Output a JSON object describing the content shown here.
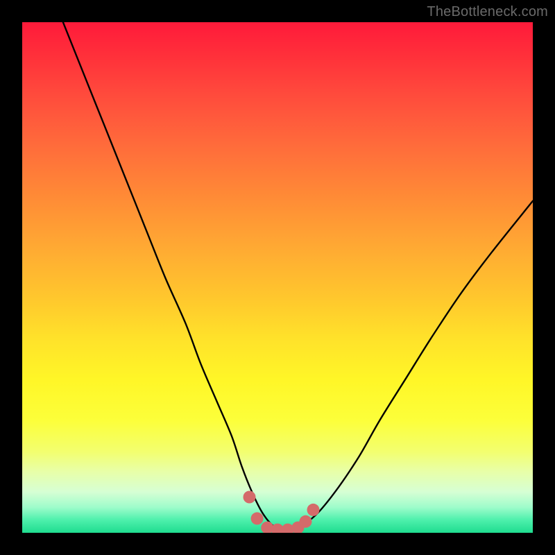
{
  "watermark": {
    "text": "TheBottleneck.com"
  },
  "colors": {
    "frame": "#000000",
    "curve": "#000000",
    "markers": "#d46a6a",
    "text": "#6a6a6a"
  },
  "chart_data": {
    "type": "line",
    "title": "",
    "xlabel": "",
    "ylabel": "",
    "xlim": [
      0,
      100
    ],
    "ylim": [
      0,
      100
    ],
    "grid": false,
    "legend": false,
    "series": [
      {
        "name": "bottleneck-curve",
        "x": [
          8,
          12,
          16,
          20,
          24,
          28,
          32,
          35,
          38,
          41,
          43,
          45,
          47,
          49,
          51,
          53,
          55,
          58,
          62,
          66,
          70,
          75,
          80,
          86,
          92,
          100
        ],
        "y": [
          100,
          90,
          80,
          70,
          60,
          50,
          41,
          33,
          26,
          19,
          13,
          8,
          4,
          1.5,
          0.5,
          0.5,
          1.5,
          4,
          9,
          15,
          22,
          30,
          38,
          47,
          55,
          65
        ]
      }
    ],
    "markers": {
      "name": "optimal-zone",
      "x": [
        44.5,
        46,
        48,
        50,
        52,
        54,
        55.5,
        57
      ],
      "y": [
        7,
        2.8,
        1,
        0.6,
        0.6,
        1,
        2.2,
        4.5
      ]
    }
  }
}
